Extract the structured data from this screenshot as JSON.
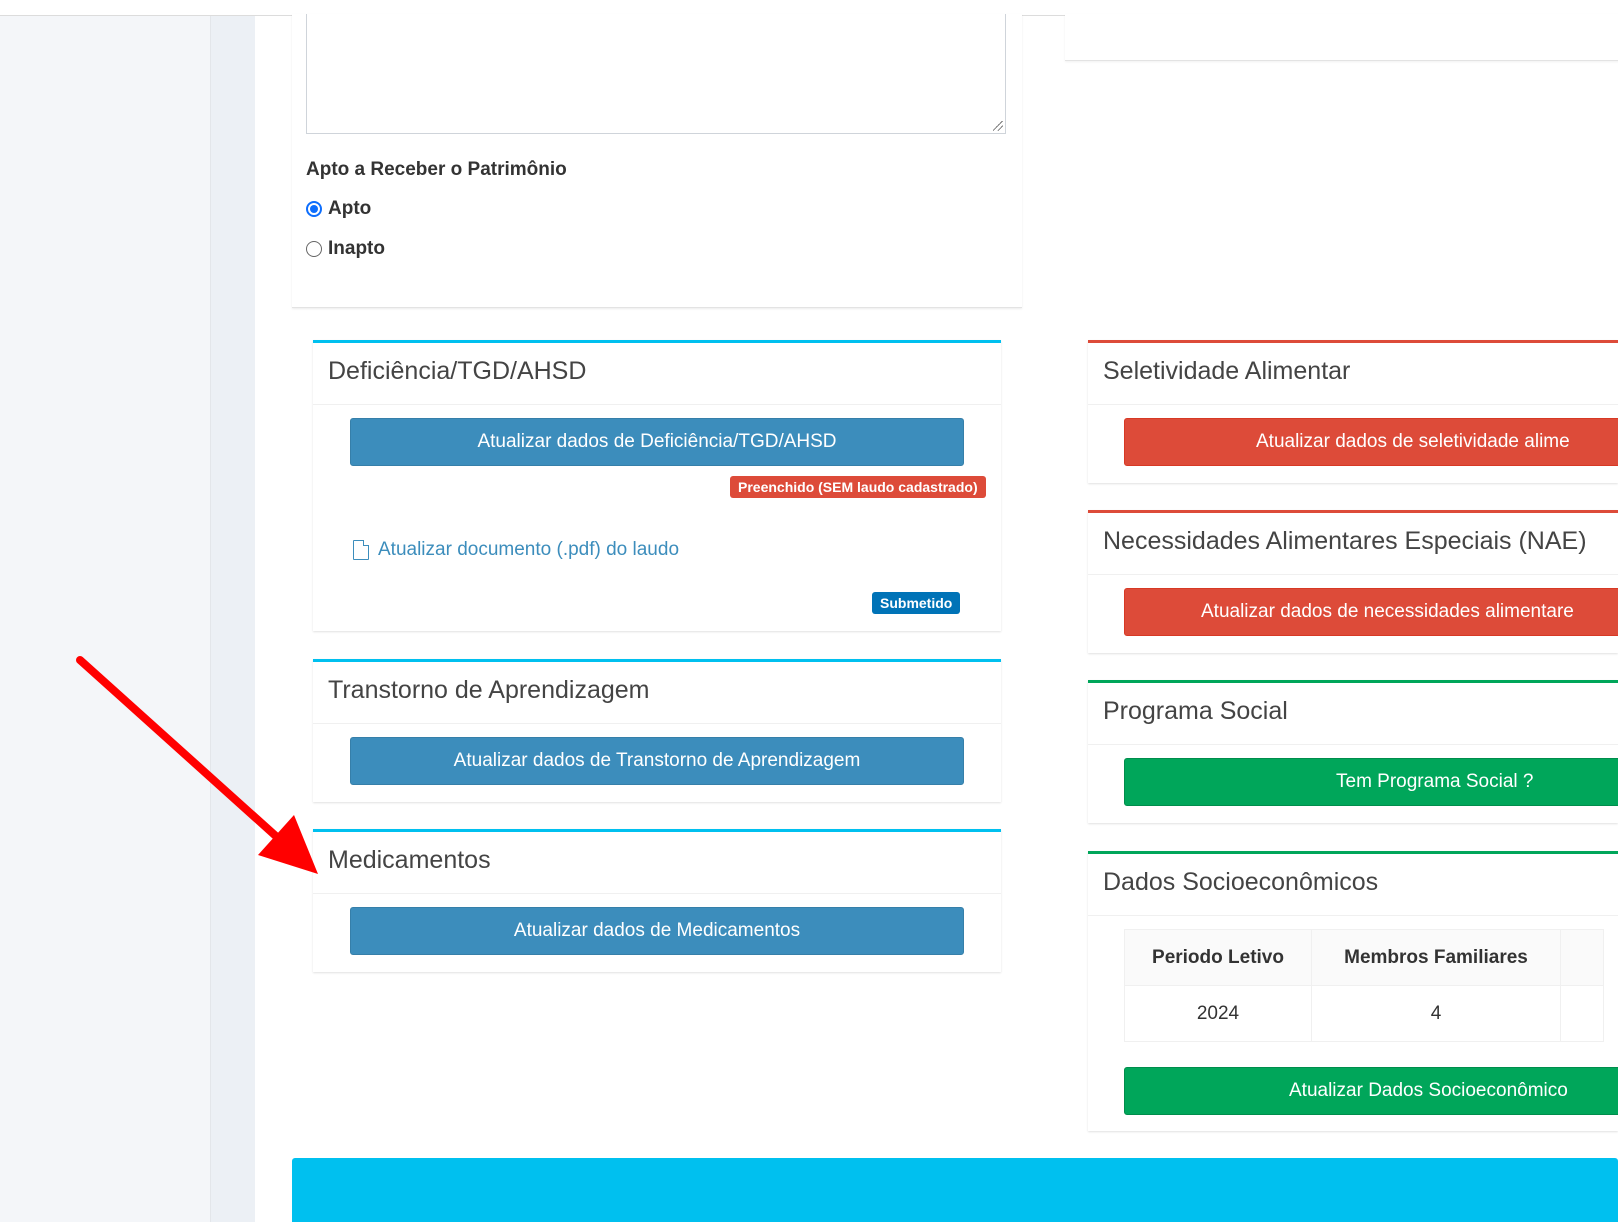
{
  "form": {
    "patrimonio_label": "Apto a Receber o Patrimônio",
    "options": [
      {
        "label": "Apto",
        "checked": true
      },
      {
        "label": "Inapto",
        "checked": false
      }
    ]
  },
  "left_panels": {
    "deficiencia": {
      "title": "Deficiência/TGD/AHSD",
      "button": "Atualizar dados de Deficiência/TGD/AHSD",
      "status_badge": "Preenchido (SEM laudo cadastrado)",
      "pdf_link": "Atualizar documento (.pdf) do laudo",
      "pdf_badge": "Submetido"
    },
    "transtorno": {
      "title": "Transtorno de Aprendizagem",
      "button": "Atualizar dados de Transtorno de Aprendizagem"
    },
    "medicamentos": {
      "title": "Medicamentos",
      "button": "Atualizar dados de Medicamentos"
    }
  },
  "right_panels": {
    "seletividade": {
      "title": "Seletividade Alimentar",
      "button": "Atualizar dados de seletividade alime"
    },
    "nae": {
      "title": "Necessidades Alimentares Especiais (NAE)",
      "button": "Atualizar dados de necessidades alimentare"
    },
    "programa_social": {
      "title": "Programa Social",
      "button": "Tem Programa Social ?"
    },
    "socio": {
      "title": "Dados Socioeconômicos",
      "columns": [
        "Periodo Letivo",
        "Membros Familiares"
      ],
      "rows": [
        [
          "2024",
          "4"
        ]
      ],
      "button": "Atualizar Dados Socioeconômico"
    }
  },
  "colors": {
    "info": "#00c0ef",
    "danger": "#dd4b39",
    "success": "#00a65a",
    "primary": "#3c8dbc",
    "annotation_arrow": "#ff0000"
  }
}
